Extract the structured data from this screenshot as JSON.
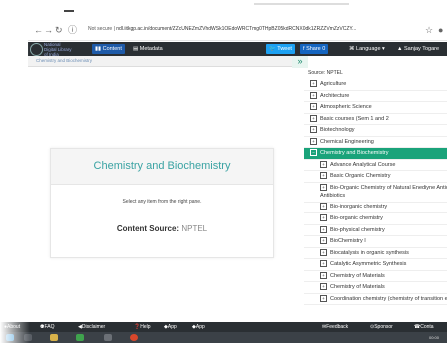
{
  "browser": {
    "security_label": "Not secure",
    "url": "ndl.iitkgp.ac.in/document/ZZcUNEZmZVhdWSk1OEdoWRCTmg0THpBZ05kdRCNX0dk1ZRZZVmZzVCZY..."
  },
  "appbar": {
    "logo_text": [
      "National",
      "Digital Library",
      "of India"
    ],
    "content_label": "Content",
    "metadata_label": "Metadata",
    "tweet_label": "Tweet",
    "share_label": "Share 0",
    "language_label": "Language",
    "user_label": "Sanjay Togare"
  },
  "breadcrumb": {
    "text": "Chemistry and Biochemistry"
  },
  "content_card": {
    "title": "Chemistry and Biochemistry",
    "instruction": "Select any item from the right pane.",
    "source_label": "Content Source:",
    "source_value": "NPTEL"
  },
  "tree": {
    "source_label": "Source: NPTEL",
    "items": [
      {
        "label": "Agriculture",
        "level": 1
      },
      {
        "label": "Architecture",
        "level": 1
      },
      {
        "label": "Atmospheric Science",
        "level": 1
      },
      {
        "label": "Basic courses (Sem 1 and 2",
        "level": 1
      },
      {
        "label": "Biotechnology",
        "level": 1
      },
      {
        "label": "Chemical Engineering",
        "level": 1
      },
      {
        "label": "Chemistry and Biochemistry",
        "level": 1,
        "selected": true
      },
      {
        "label": "Advance Analytical Course",
        "level": 2
      },
      {
        "label": "Basic Organic Chemistry",
        "level": 2
      },
      {
        "label": "Bio-Organic Chemistry of Natural Enediyne Anticancer Antibiotics",
        "level": 2,
        "wrap": true
      },
      {
        "label": "Bio-inorganic chemistry",
        "level": 2
      },
      {
        "label": "Bio-organic chemistry",
        "level": 2
      },
      {
        "label": "Bio-physical chemistry",
        "level": 2
      },
      {
        "label": "BioChemistry I",
        "level": 2
      },
      {
        "label": "Biocatalysis in organic synthesis",
        "level": 2
      },
      {
        "label": "Catalytic Asymmetric Synthesis",
        "level": 2
      },
      {
        "label": "Chemistry of Materials",
        "level": 2
      },
      {
        "label": "Chemistry of Materials",
        "level": 2
      },
      {
        "label": "Coordination chemistry (chemistry of transition el",
        "level": 2
      }
    ]
  },
  "footer": {
    "about": "About",
    "faq": "FAQ",
    "disclaimer": "Disclaimer",
    "help": "Help",
    "app1": "App",
    "app2": "App",
    "feedback": "Feedback",
    "sponsor": "Sponsor",
    "contact": "Conta"
  },
  "taskbar": {
    "clock": "00:00"
  }
}
